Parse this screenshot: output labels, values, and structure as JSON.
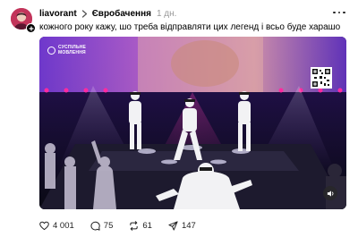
{
  "post": {
    "username": "liavorant",
    "topic": "Євробачення",
    "time": "1 дн.",
    "caption": "кожного року кажу, шо треба відправляти цих легенд і всьо буде харашо"
  },
  "video": {
    "logo_line1": "СУСПІЛЬНЕ",
    "logo_line2": "МОВЛЕННЯ",
    "sound_icon": "speaker-icon"
  },
  "actions": {
    "likes": "4 001",
    "comments": "75",
    "reposts": "61",
    "shares": "147"
  },
  "icons": {
    "more": "more-icon",
    "like": "heart-icon",
    "comment": "comment-icon",
    "repost": "repost-icon",
    "share": "share-icon"
  },
  "colors": {
    "accent_text": "#000000",
    "muted": "#999999",
    "stage_purple": "#7a2be0",
    "stage_pink": "#e01d8f"
  }
}
